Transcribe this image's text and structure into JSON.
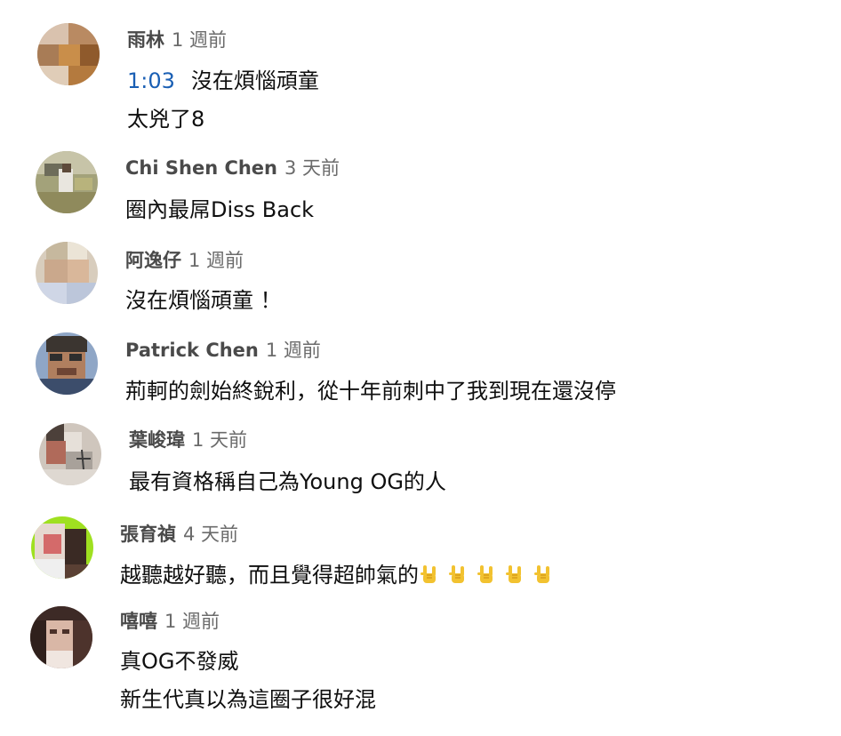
{
  "comments": [
    {
      "author": "雨林",
      "time": "1 週前",
      "timestamp_link": "1:03",
      "lines": [
        "沒在煩惱頑童",
        "太兇了8"
      ]
    },
    {
      "author": "Chi Shen Chen",
      "time": "3 天前",
      "lines": [
        "圈內最屌Diss Back"
      ]
    },
    {
      "author": "阿逸仔",
      "time": "1 週前",
      "lines": [
        "沒在煩惱頑童 ！"
      ]
    },
    {
      "author": "Patrick Chen",
      "time": "1 週前",
      "lines": [
        "荊軻的劍始終銳利，從十年前刺中了我到現在還沒停"
      ]
    },
    {
      "author": "葉峻瑋",
      "time": "1 天前",
      "lines": [
        "最有資格稱自己為Young OG的人"
      ]
    },
    {
      "author": "張育禎",
      "time": "4 天前",
      "lines": [
        "越聽越好聽，而且覺得超帥氣的"
      ],
      "emoji_icons": [
        "rock-on-hand-icon",
        "rock-on-hand-icon",
        "rock-on-hand-icon",
        "rock-on-hand-icon",
        "rock-on-hand-icon"
      ]
    },
    {
      "author": "嘻嘻",
      "time": "1 週前",
      "lines": [
        "真OG不發威",
        "新生代真以為這圈子很好混"
      ]
    }
  ],
  "colors": {
    "text": "#0f0f0f",
    "author": "#4a4a4a",
    "time": "#6b6b6b",
    "link": "#1a5fb4",
    "emoji": "#f2c230"
  }
}
